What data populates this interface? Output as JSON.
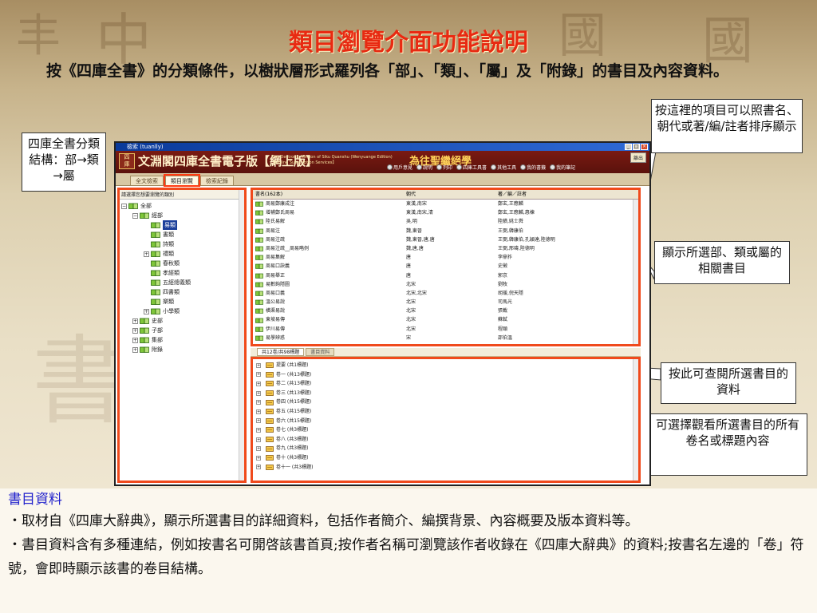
{
  "slide": {
    "title": "類目瀏覽介面功能說明",
    "lead": "按《四庫全書》的分類條件，以樹狀層形式羅列各「部」、「類」、「屬」及「附錄」的書目及內容資料。"
  },
  "callouts": {
    "structure": "四庫全書分類結構：部→類→屬",
    "sort_hint": "按這裡的項目可以照書名、朝代或著/編/註者排序顯示",
    "book_list": "顯示所選部、類或屬的相關書目",
    "catalog": "按此可查閱所選書目的資料",
    "volumes": "可選擇觀看所選書目的所有卷名或標題內容"
  },
  "window": {
    "titlebar": "檢索 (tuanlly)",
    "buttons": [
      "_",
      "□",
      "×"
    ],
    "banner_name": "文淵閣四庫全書電子版【網上版】",
    "banner_en": "The Electronic Version of Siku Quanshu (Wenyuange Edition) 【Online Subscription Services】",
    "banner_motto": "為往聖繼絕學",
    "exit_label": "離出",
    "tools": [
      {
        "icon": "user-icon",
        "label": "用戶意見"
      },
      {
        "icon": "help-icon",
        "label": "說明"
      },
      {
        "icon": "print-icon",
        "label": "列印"
      },
      {
        "icon": "reference-icon",
        "label": "四庫工具書"
      },
      {
        "icon": "tools-icon",
        "label": "其他工具"
      },
      {
        "icon": "bookshelf-icon",
        "label": "我的書籤"
      },
      {
        "icon": "notes-icon",
        "label": "我的筆記"
      }
    ],
    "tabs": [
      "全文檢索",
      "類目瀏覽",
      "檢索紀錄"
    ],
    "active_tab": 1
  },
  "tree": {
    "caption": "請選擇您想要瀏覽的類別",
    "items": [
      {
        "label": "全部",
        "level": 0,
        "exp": "−"
      },
      {
        "label": "經部",
        "level": 1,
        "exp": "−"
      },
      {
        "label": "易類",
        "level": 2,
        "exp": "",
        "selected": true
      },
      {
        "label": "書類",
        "level": 2,
        "exp": ""
      },
      {
        "label": "詩類",
        "level": 2,
        "exp": ""
      },
      {
        "label": "禮類",
        "level": 2,
        "exp": "+"
      },
      {
        "label": "春秋類",
        "level": 2,
        "exp": ""
      },
      {
        "label": "孝經類",
        "level": 2,
        "exp": ""
      },
      {
        "label": "五經總義類",
        "level": 2,
        "exp": ""
      },
      {
        "label": "四書類",
        "level": 2,
        "exp": ""
      },
      {
        "label": "樂類",
        "level": 2,
        "exp": ""
      },
      {
        "label": "小學類",
        "level": 2,
        "exp": "+"
      },
      {
        "label": "史部",
        "level": 1,
        "exp": "+"
      },
      {
        "label": "子部",
        "level": 1,
        "exp": "+"
      },
      {
        "label": "集部",
        "level": 1,
        "exp": "+"
      },
      {
        "label": "附錄",
        "level": 1,
        "exp": "+"
      }
    ]
  },
  "book_list": {
    "headers": [
      "書名(162本)",
      "朝代",
      "著／編／註者"
    ],
    "rows": [
      [
        "周易鄭康成注",
        "東漢,南宋",
        "鄭玄,王應麟"
      ],
      [
        "增補鄭氏周易",
        "東漢,南宋,清",
        "鄭玄,王應麟,惠棟"
      ],
      [
        "陸氏易解",
        "吳,明",
        "陸績,姚士粦"
      ],
      [
        "周易注",
        "魏,東晉",
        "王弼,韓康伯"
      ],
      [
        "周易注疏",
        "魏,東晉,唐,唐",
        "王弼,韓康伯,孔穎達,陸德明"
      ],
      [
        "周易注疏__周易略例",
        "魏,唐,唐",
        "王弼,邢璹,陸德明"
      ],
      [
        "周易集解",
        "唐",
        "李鼎祚"
      ],
      [
        "周易口訣義",
        "唐",
        "史徵"
      ],
      [
        "周易舉正",
        "唐",
        "郭京"
      ],
      [
        "易數鉤隱圖",
        "北宋",
        "劉牧"
      ],
      [
        "周易口義",
        "北宋,北宋",
        "胡瑗,倪天隱"
      ],
      [
        "溫公易說",
        "北宋",
        "司馬光"
      ],
      [
        "橫渠易說",
        "北宋",
        "張載"
      ],
      [
        "東坡易傳",
        "北宋",
        "蘇軾"
      ],
      [
        "伊川易傳",
        "北宋",
        "程頤"
      ],
      [
        "易學辨惑",
        "宋",
        "邵伯溫"
      ]
    ]
  },
  "volume_tabs": [
    "共12卷/共98標題",
    "書目資料"
  ],
  "volumes": [
    "提要 (共1標題)",
    "卷一 (共13標題)",
    "卷二 (共13標題)",
    "卷三 (共13標題)",
    "卷四 (共15標題)",
    "卷五 (共15標題)",
    "卷六 (共15標題)",
    "卷七 (共3標題)",
    "卷八 (共3標題)",
    "卷九 (共3標題)",
    "卷十 (共3標題)",
    "卷十一 (共3標題)"
  ],
  "info": {
    "heading": "書目資料",
    "bullets": [
      "・取材自《四庫大辭典》，顯示所選書目的詳細資料，包括作者簡介、編撰背景、內容概要及版本資料等。",
      "・書目資料含有多種連結，例如按書名可開啓該書首頁;按作者名稱可瀏覽該作者收錄在《四庫大辭典》的資料;按書名左邊的「卷」符號，會即時顯示該書的卷目結構。"
    ]
  },
  "colors": {
    "title": "#e82a12",
    "highlight_border": "#f04a1c",
    "info_heading": "#2222cc",
    "window_banner": "#7a1a12"
  }
}
